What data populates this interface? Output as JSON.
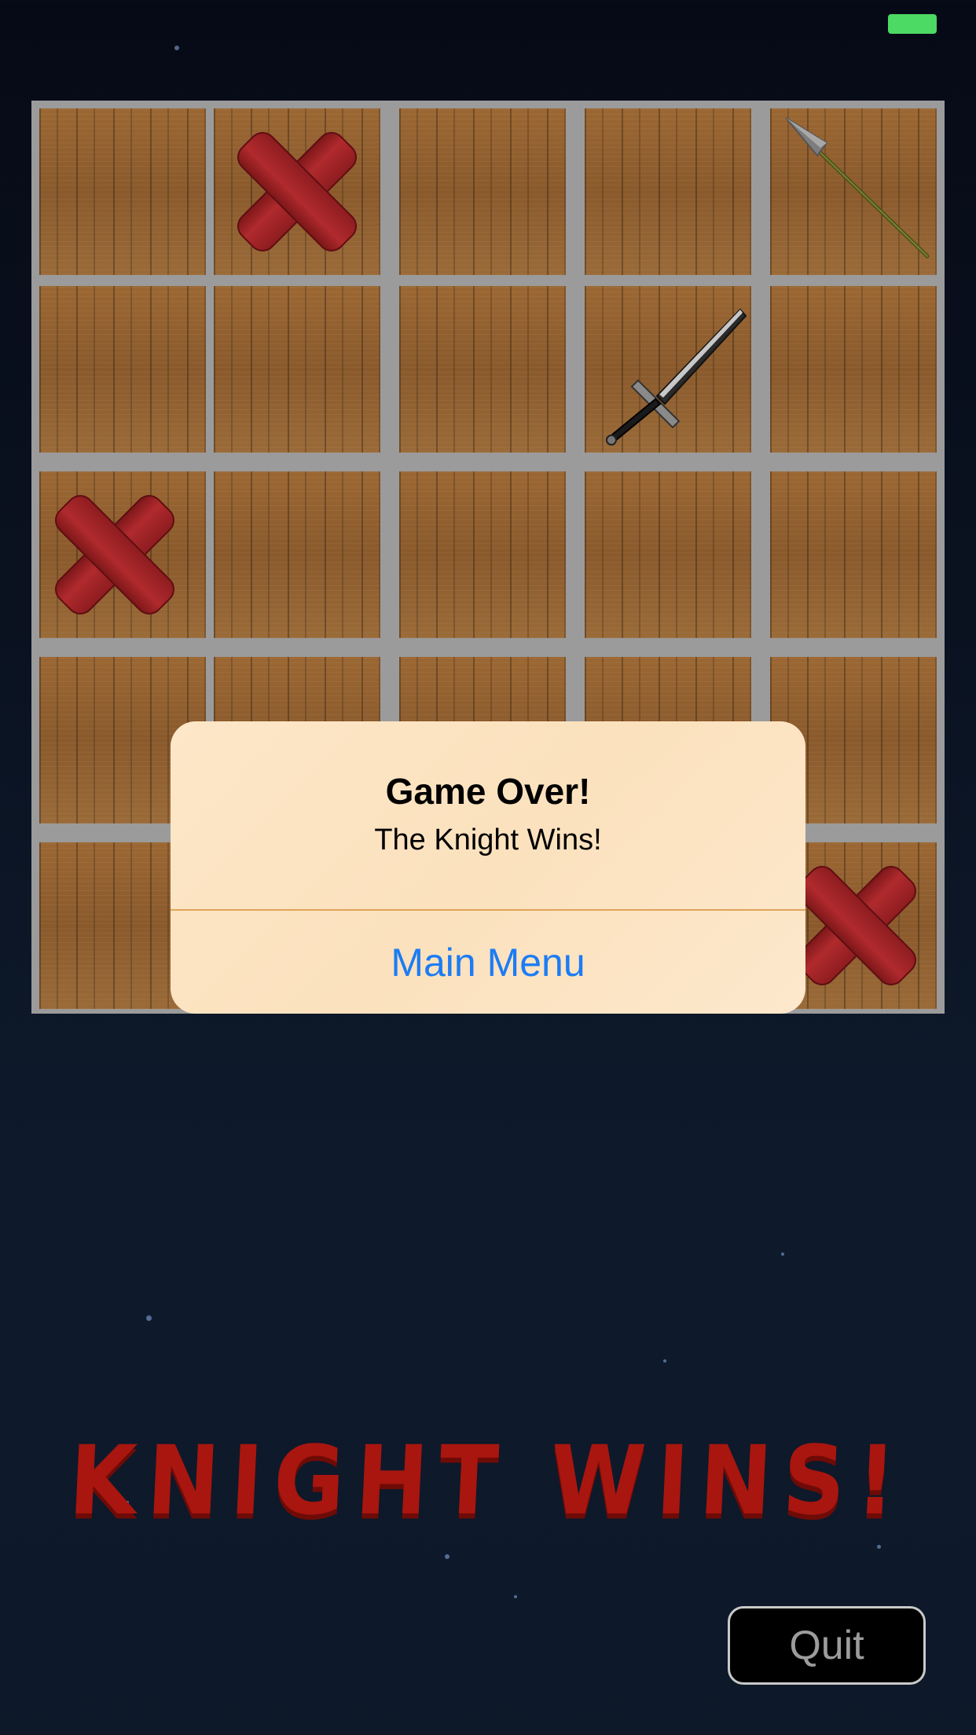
{
  "status_bar": {
    "battery_color": "#4cd964"
  },
  "board": {
    "rows": 5,
    "cols": 5,
    "cells": [
      [
        "",
        "x",
        "",
        "",
        "spear"
      ],
      [
        "",
        "",
        "",
        "sword",
        ""
      ],
      [
        "x",
        "",
        "",
        "",
        ""
      ],
      [
        "",
        "",
        "",
        "",
        ""
      ],
      [
        "",
        "",
        "",
        "",
        "x"
      ]
    ]
  },
  "dialog": {
    "title": "Game Over!",
    "message": "The Knight Wins!",
    "button_label": "Main Menu"
  },
  "banner": {
    "text": "KNIGHT WINS!"
  },
  "quit_button": {
    "label": "Quit"
  },
  "colors": {
    "x_mark": "#b02a2d",
    "banner_text": "#a8160f",
    "dialog_button": "#1c7cf4"
  }
}
